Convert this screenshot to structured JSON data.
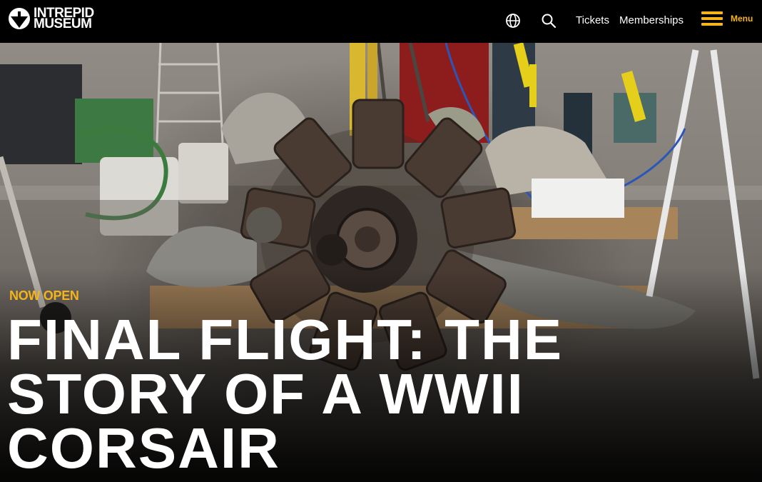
{
  "header": {
    "logo_line1": "INTREPID",
    "logo_line2": "MUSEUM",
    "logo_icon": "intrepid-logo-mark",
    "language_icon": "globe-icon",
    "search_icon": "search-icon",
    "tickets_label": "Tickets",
    "memberships_label": "Memberships",
    "menu_icon": "hamburger-icon",
    "menu_label": "Menu"
  },
  "hero": {
    "eyebrow": "NOW OPEN",
    "title_lines": [
      "FINAL FLIGHT: THE",
      "STORY OF A WWII",
      "CORSAIR"
    ],
    "image_subject": "radial engine and propeller on workshop floor"
  },
  "colors": {
    "accent": "#f4b41a",
    "header_bg": "#000000",
    "text": "#ffffff"
  }
}
